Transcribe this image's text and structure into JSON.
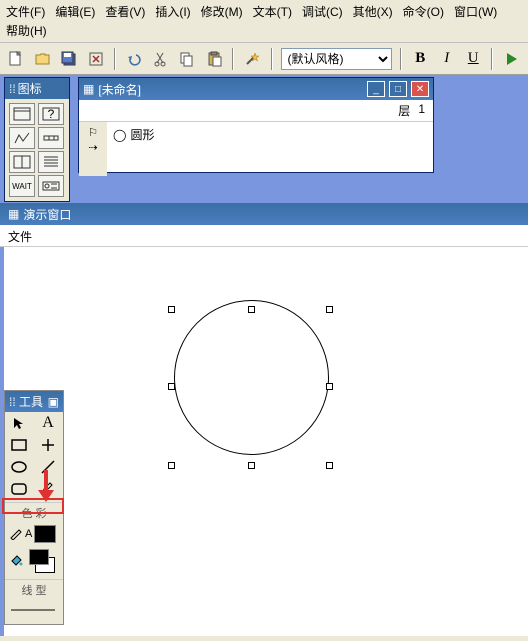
{
  "menus": {
    "file": "文件(F)",
    "edit": "编辑(E)",
    "view": "查看(V)",
    "insert": "插入(I)",
    "modify": "修改(M)",
    "text": "文本(T)",
    "debug": "调试(C)",
    "other": "其他(X)",
    "command": "命令(O)",
    "window": "窗口(W)",
    "help": "帮助(H)"
  },
  "style_select": "(默认风格)",
  "format": {
    "bold": "B",
    "italic": "I",
    "underline": "U"
  },
  "palettes": {
    "icons_title": "图标",
    "tools_title": "工具",
    "color_section": "色 彩",
    "line_section": "线 型"
  },
  "docwin": {
    "title": "[未命名]",
    "layer_label": "层",
    "layer_value": "1",
    "tree_item": "圆形"
  },
  "demo": {
    "title": "演示窗口",
    "menu_file": "文件"
  },
  "icons": {
    "new": "new",
    "open": "open",
    "save": "save",
    "close": "close",
    "undo": "undo",
    "cut": "cut",
    "copy": "copy",
    "paste": "paste",
    "magic": "magic",
    "play": "play"
  }
}
